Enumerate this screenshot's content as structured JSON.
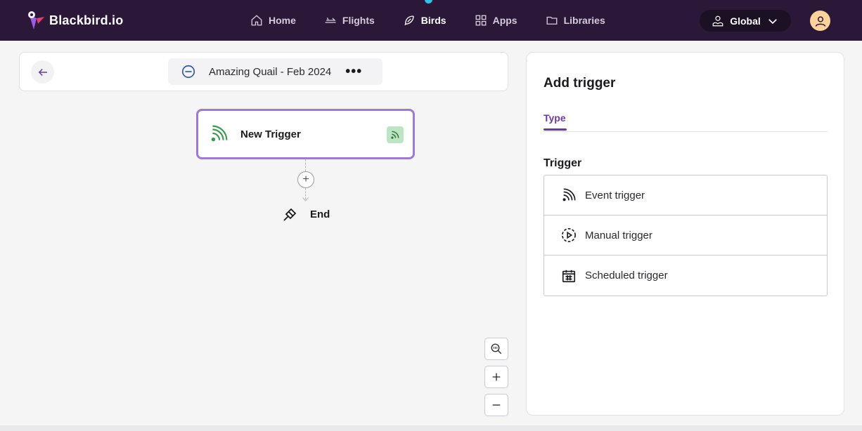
{
  "brand": {
    "name": "Blackbird.io"
  },
  "nav": [
    {
      "label": "Home",
      "icon": "home-icon",
      "active": false
    },
    {
      "label": "Flights",
      "icon": "plane-icon",
      "active": false
    },
    {
      "label": "Birds",
      "icon": "feather-icon",
      "active": true
    },
    {
      "label": "Apps",
      "icon": "grid-icon",
      "active": false
    },
    {
      "label": "Libraries",
      "icon": "folder-icon",
      "active": false
    }
  ],
  "workspace": {
    "label": "Global"
  },
  "flow": {
    "title": "Amazing Quail - Feb 2024",
    "trigger_card_label": "New Trigger",
    "end_label": "End"
  },
  "panel": {
    "title": "Add trigger",
    "tab": "Type",
    "section": "Trigger",
    "options": [
      {
        "label": "Event trigger",
        "icon": "rss-icon"
      },
      {
        "label": "Manual trigger",
        "icon": "play-circle-icon"
      },
      {
        "label": "Scheduled trigger",
        "icon": "calendar-icon"
      }
    ]
  },
  "colors": {
    "nav_bg": "#2b1838",
    "accent": "#6a3aa8",
    "card_border": "#9d7ad6",
    "active_dot": "#33c3e4"
  }
}
